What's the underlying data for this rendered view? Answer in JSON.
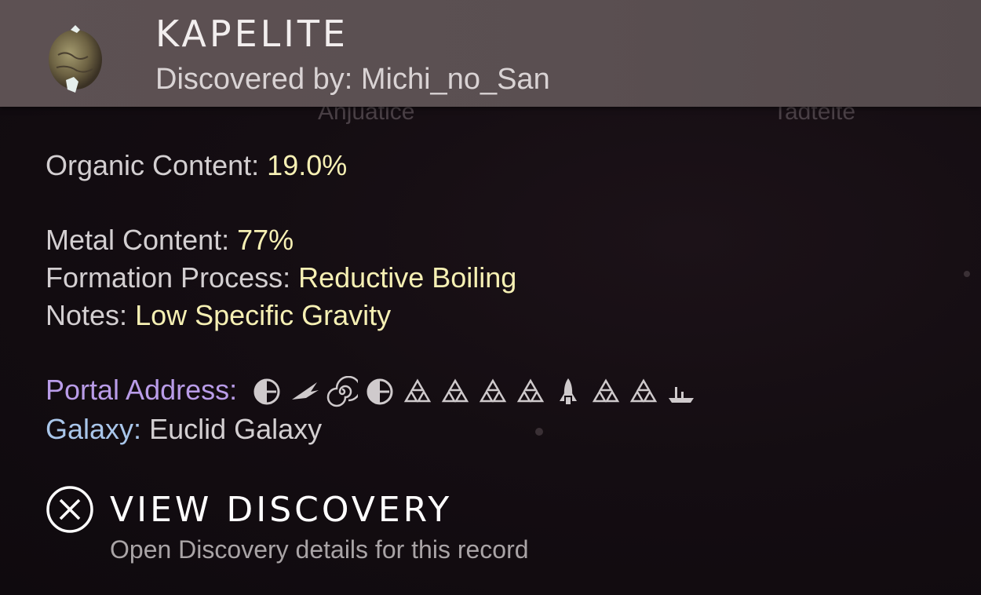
{
  "background_labels": [
    "Anjuatice",
    "Tadteite"
  ],
  "header": {
    "title": "KAPELITE",
    "discovered_by": "Discovered by: Michi_no_San"
  },
  "stats": {
    "organic_label": "Organic Content:",
    "organic_value": "19.0%",
    "metal_label": "Metal Content:",
    "metal_value": "77%",
    "formation_label": "Formation Process:",
    "formation_value": "Reductive Boiling",
    "notes_label": "Notes:",
    "notes_value": "Low Specific Gravity",
    "portal_label": "Portal Address:",
    "portal_glyphs": [
      "eclipse-glyph",
      "bird-glyph",
      "spiral-glyph",
      "eclipse-glyph",
      "triangles-glyph",
      "triangles-glyph",
      "triangles-glyph",
      "triangles-glyph",
      "rocket-glyph",
      "triangles-glyph",
      "triangles-glyph",
      "boat-glyph"
    ],
    "galaxy_label": "Galaxy:",
    "galaxy_value": "Euclid Galaxy"
  },
  "action": {
    "button_icon": "cross-button-icon",
    "label": "VIEW DISCOVERY",
    "description": "Open Discovery details for this record"
  },
  "colors": {
    "value_yellow": "#f6f0b4",
    "portal_purple": "#b99ce8",
    "galaxy_blue": "#a9c6ea",
    "header_bg": "#5d5153"
  }
}
